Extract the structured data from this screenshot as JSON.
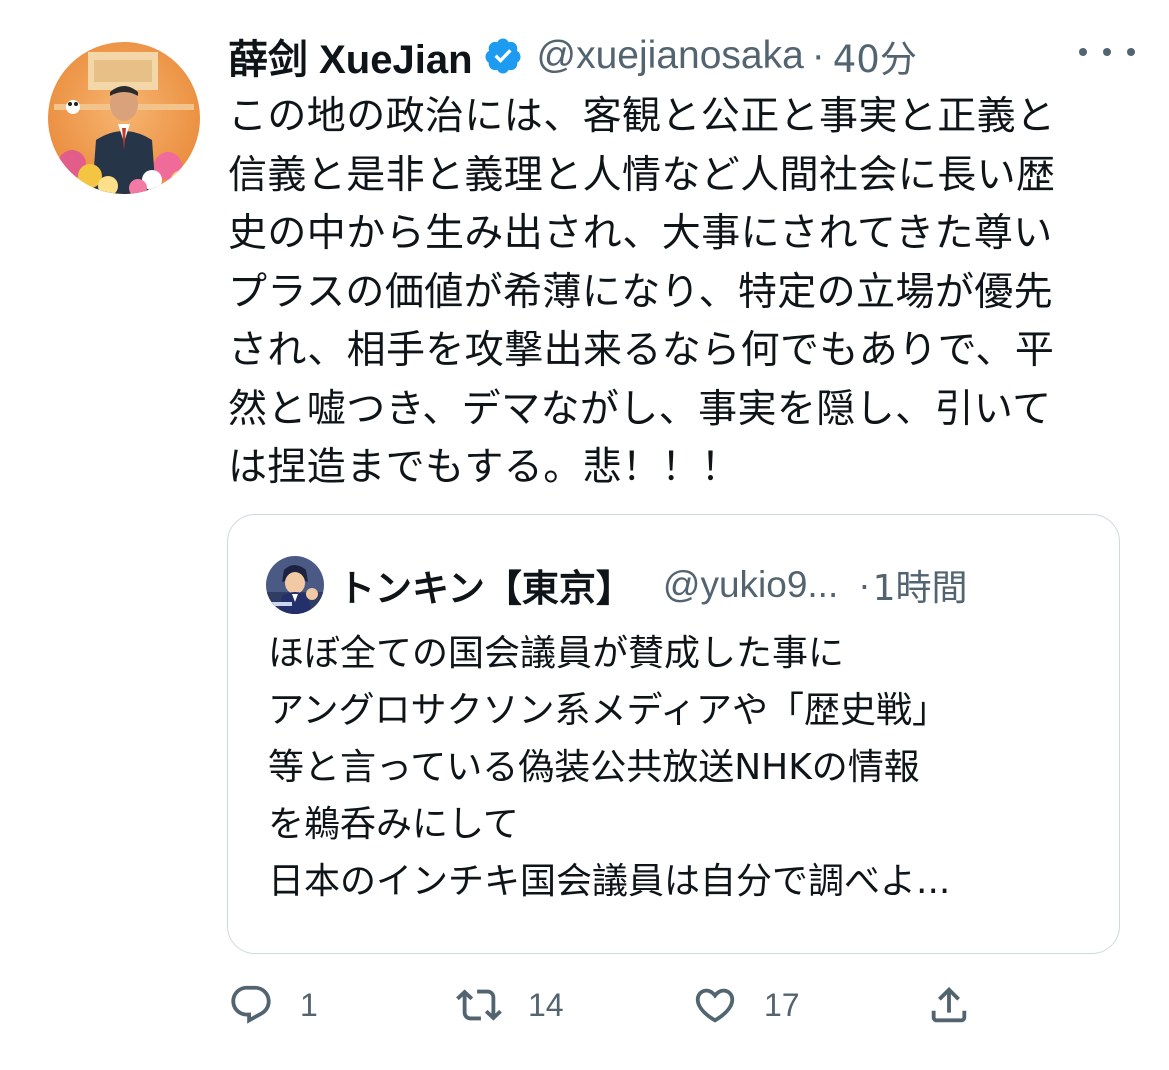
{
  "tweet": {
    "display_name": "薛剑 XueJian",
    "handle": "@xuejianosaka",
    "separator": "·",
    "time": "40分",
    "verified_icon": "verified-badge-icon",
    "text": "この地の政治には、客観と公正と事実と正義と\n信義と是非と義理と人情など人間社会に長い歴\n史の中から生み出され、大事にされてきた尊い\nプラスの価値が希薄になり、特定の立場が優先\nされ、相手を攻撃出来るなら何でもありで、平\n然と嘘つき、デマながし、事実を隠し、引いて\nは捏造までもする。悲！！！"
  },
  "quote": {
    "display_name": "トンキン【東京】",
    "handle": "@yukio9...",
    "separator": "·",
    "time": "1時間",
    "text": "ほぼ全ての国会議員が賛成した事に\nアングロサクソン系メディアや「歴史戦」\n等と言っている偽装公共放送NHKの情報\nを鵜呑みにして\n日本のインチキ国会議員は自分で調べよ..."
  },
  "actions": {
    "reply_count": "1",
    "retweet_count": "14",
    "like_count": "17"
  },
  "colors": {
    "accent": "#1d9bf0",
    "text": "#0f1419",
    "muted": "#536471",
    "border": "#cfd9de"
  }
}
